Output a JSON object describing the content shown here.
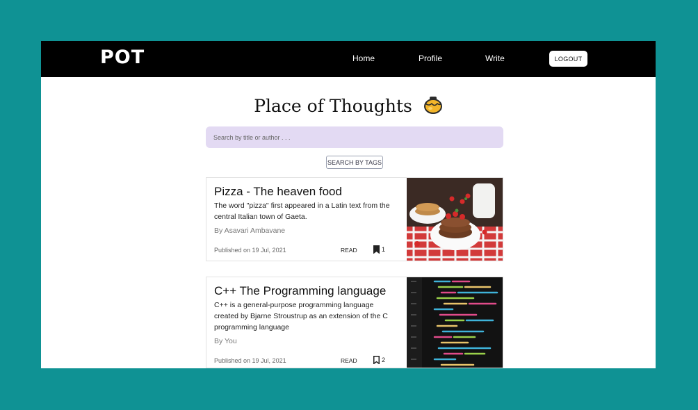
{
  "nav": {
    "logo": "POT",
    "links": [
      "Home",
      "Profile",
      "Write"
    ],
    "logout_label": "LOGOUT"
  },
  "main": {
    "title": "Place of Thoughts",
    "search_placeholder": "Search by title or author . . .",
    "tags_button_label": "SEARCH BY TAGS"
  },
  "posts": [
    {
      "title": "Pizza - The heaven food",
      "description": "The word \"pizza\" first appeared in a Latin text from the central Italian town of Gaeta.",
      "author": "By Asavari Ambavane",
      "published": "Published on 19 Jul, 2021",
      "read_label": "READ",
      "bookmark_count": "1",
      "bookmarked": true,
      "image_icon": "pancakes-photo"
    },
    {
      "title": "C++ The Programming language",
      "description": "C++ is a general-purpose programming language created by Bjarne Stroustrup as an extension of the C programming language",
      "author": "By You",
      "published": "Published on 19 Jul, 2021",
      "read_label": "READ",
      "bookmark_count": "2",
      "bookmarked": false,
      "image_icon": "code-screen-photo"
    }
  ],
  "colors": {
    "background": "#0f9294",
    "navbar": "#000000",
    "search_bg": "#e3daf3"
  }
}
